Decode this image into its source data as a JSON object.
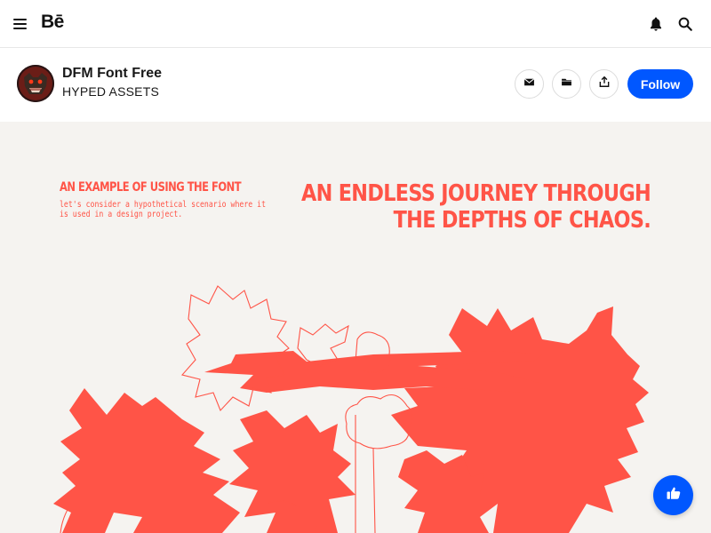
{
  "nav": {
    "logo": "Bē",
    "icons": [
      "menu-icon",
      "bell-icon",
      "search-icon"
    ]
  },
  "project": {
    "title": "DFM Font Free",
    "owner": "HYPED ASSETS",
    "actions": [
      "mail-icon",
      "folder-icon",
      "share-icon"
    ],
    "follow_label": "Follow"
  },
  "artwork": {
    "heading_left": "AN EXAMPLE OF USING THE FONT",
    "body_left": "let's consider a hypothetical scenario where it is used in a design project.",
    "heading_right_line1": "AN ENDLESS JOURNEY THROUGH",
    "heading_right_line2": "THE DEPTHS OF CHAOS.",
    "accent_color": "#ff5447",
    "background_color": "#f5f3f0"
  },
  "fab": {
    "icon": "thumbs-up-icon"
  },
  "colors": {
    "brand": "#0057ff"
  }
}
